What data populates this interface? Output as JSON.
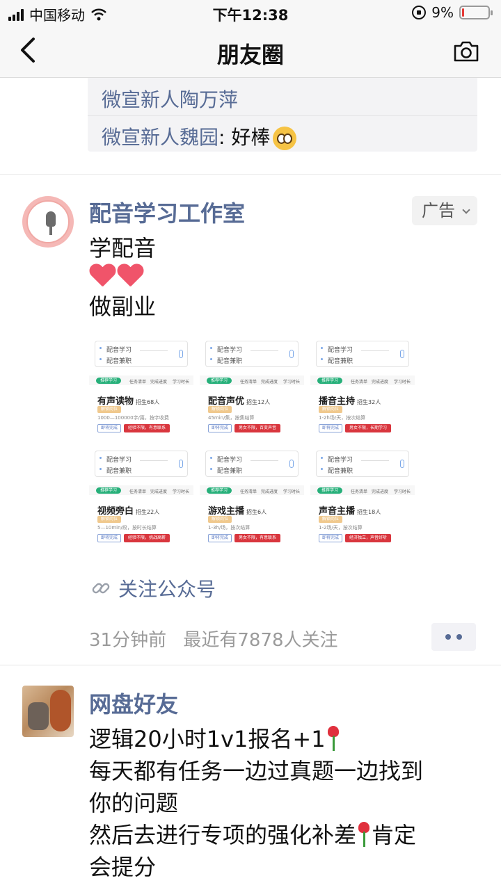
{
  "status_bar": {
    "carrier": "中国移动",
    "time": "下午12:38",
    "battery_percent": "9%",
    "battery_level": 0.09,
    "battery_color": "#e53935"
  },
  "nav": {
    "title": "朋友圈",
    "back_icon": "chevron-left-icon",
    "camera_icon": "camera-icon"
  },
  "prev_post_comments": [
    {
      "user": "微宣新人陶万萍",
      "text": ""
    },
    {
      "user": "微宣新人魏园",
      "text": ": 好棒"
    }
  ],
  "ad_post": {
    "name": "配音学习工作室",
    "ad_label": "广告",
    "lines": [
      "学配音",
      "做副业"
    ],
    "link_text": "关注公众号",
    "time": "31分钟前",
    "follow_info": "最近有7878人关注",
    "cards": [
      {
        "top1": "配音学习",
        "top2": "配音兼职",
        "title": "有声读物",
        "recruit": "招生68人",
        "badge": "解锁岗位",
        "desc": "1000—100000字/篇，按字收费",
        "btn1": "即将完成",
        "btn2": "经验不限，有意联系"
      },
      {
        "top1": "配音学习",
        "top2": "配音兼职",
        "title": "配音声优",
        "recruit": "招生12人",
        "badge": "解锁岗位",
        "desc": "45min/集，按集结算",
        "btn1": "即将完成",
        "btn2": "男女不限，百变声音"
      },
      {
        "top1": "配音学习",
        "top2": "配音兼职",
        "title": "播音主持",
        "recruit": "招生32人",
        "badge": "解锁岗位",
        "desc": "1-2h场/天，按次结算",
        "btn1": "即将完成",
        "btn2": "男女不限，长期学习"
      },
      {
        "top1": "配音学习",
        "top2": "配音兼职",
        "title": "视频旁白",
        "recruit": "招生22人",
        "badge": "解锁岗位",
        "desc": "5—10min/段，按时长结算",
        "btn1": "即将完成",
        "btn2": "经验不限，挑战高薪"
      },
      {
        "top1": "配音学习",
        "top2": "配音兼职",
        "title": "游戏主播",
        "recruit": "招生6人",
        "badge": "解锁岗位",
        "desc": "1-3h/场，按次结算",
        "btn1": "即将完成",
        "btn2": "男女不限，有意联系"
      },
      {
        "top1": "配音学习",
        "top2": "配音兼职",
        "title": "声音主播",
        "recruit": "招生18人",
        "badge": "解锁岗位",
        "desc": "1-2场/天，按次结算",
        "btn1": "即将完成",
        "btn2": "经济独立，声音好听"
      }
    ],
    "card_tabs": [
      "推荐学习",
      "任务清单",
      "完成进度",
      "学习时长"
    ]
  },
  "friend_post": {
    "name": "网盘好友",
    "lines": [
      "逻辑20小时1v1报名+1",
      "每天都有任务一边过真题一边找到",
      "你的问题",
      "然后去进行专项的强化补差",
      "肯定",
      "会提分"
    ]
  }
}
